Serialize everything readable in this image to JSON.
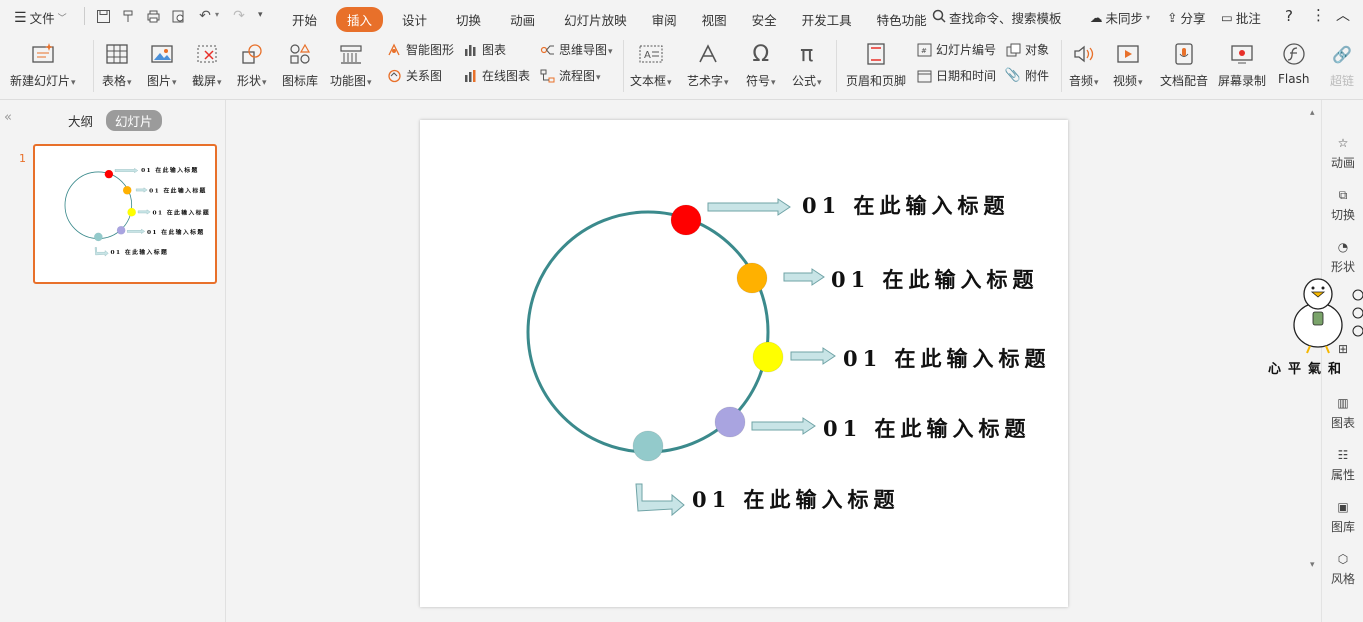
{
  "menu": {
    "file_label": "文件",
    "tabs": [
      "开始",
      "插入",
      "设计",
      "切换",
      "动画",
      "幻灯片放映",
      "审阅",
      "视图",
      "安全",
      "开发工具",
      "特色功能"
    ],
    "active_tab": "插入",
    "search_placeholder": "查找命令、搜索模板",
    "sync_label": "未同步",
    "share_label": "分享",
    "comment_label": "批注",
    "help_label": "?"
  },
  "ribbon": {
    "new_slide": "新建幻灯片",
    "table": "表格",
    "picture": "图片",
    "screenshot": "截屏",
    "shape": "形状",
    "icon_lib": "图标库",
    "function_chart": "功能图",
    "smart_shape": "智能图形",
    "chart": "图表",
    "mind_map": "思维导图",
    "relation": "关系图",
    "online_chart": "在线图表",
    "flowchart": "流程图",
    "textbox": "文本框",
    "wordart": "艺术字",
    "symbol": "符号",
    "formula": "公式",
    "header_footer": "页眉和页脚",
    "slide_number": "幻灯片编号",
    "object": "对象",
    "date_time": "日期和时间",
    "attachment": "附件",
    "audio": "音频",
    "video": "视频",
    "doc_dub": "文档配音",
    "screen_record": "屏幕录制",
    "flash": "Flash",
    "hyperlink": "超链"
  },
  "left_panel": {
    "outline_tab": "大纲",
    "slides_tab": "幻灯片",
    "slide_number": "1"
  },
  "slide": {
    "items": [
      {
        "text": "01 在此输入标题",
        "color": "#ff0000"
      },
      {
        "text": "01 在此输入标题",
        "color": "#ffb100"
      },
      {
        "text": "01 在此输入标题",
        "color": "#ffff00"
      },
      {
        "text": "01 在此输入标题",
        "color": "#a9a4e0"
      },
      {
        "text": "01 在此输入标题",
        "color": "#93cacb"
      }
    ],
    "circle_color": "#3b8a8c",
    "arrow_fill": "#c8e4e6"
  },
  "right_bar": {
    "items": [
      "动画",
      "切换",
      "形状",
      "图表",
      "属性",
      "图库",
      "风格"
    ]
  },
  "overlay_text": "心平氣和"
}
